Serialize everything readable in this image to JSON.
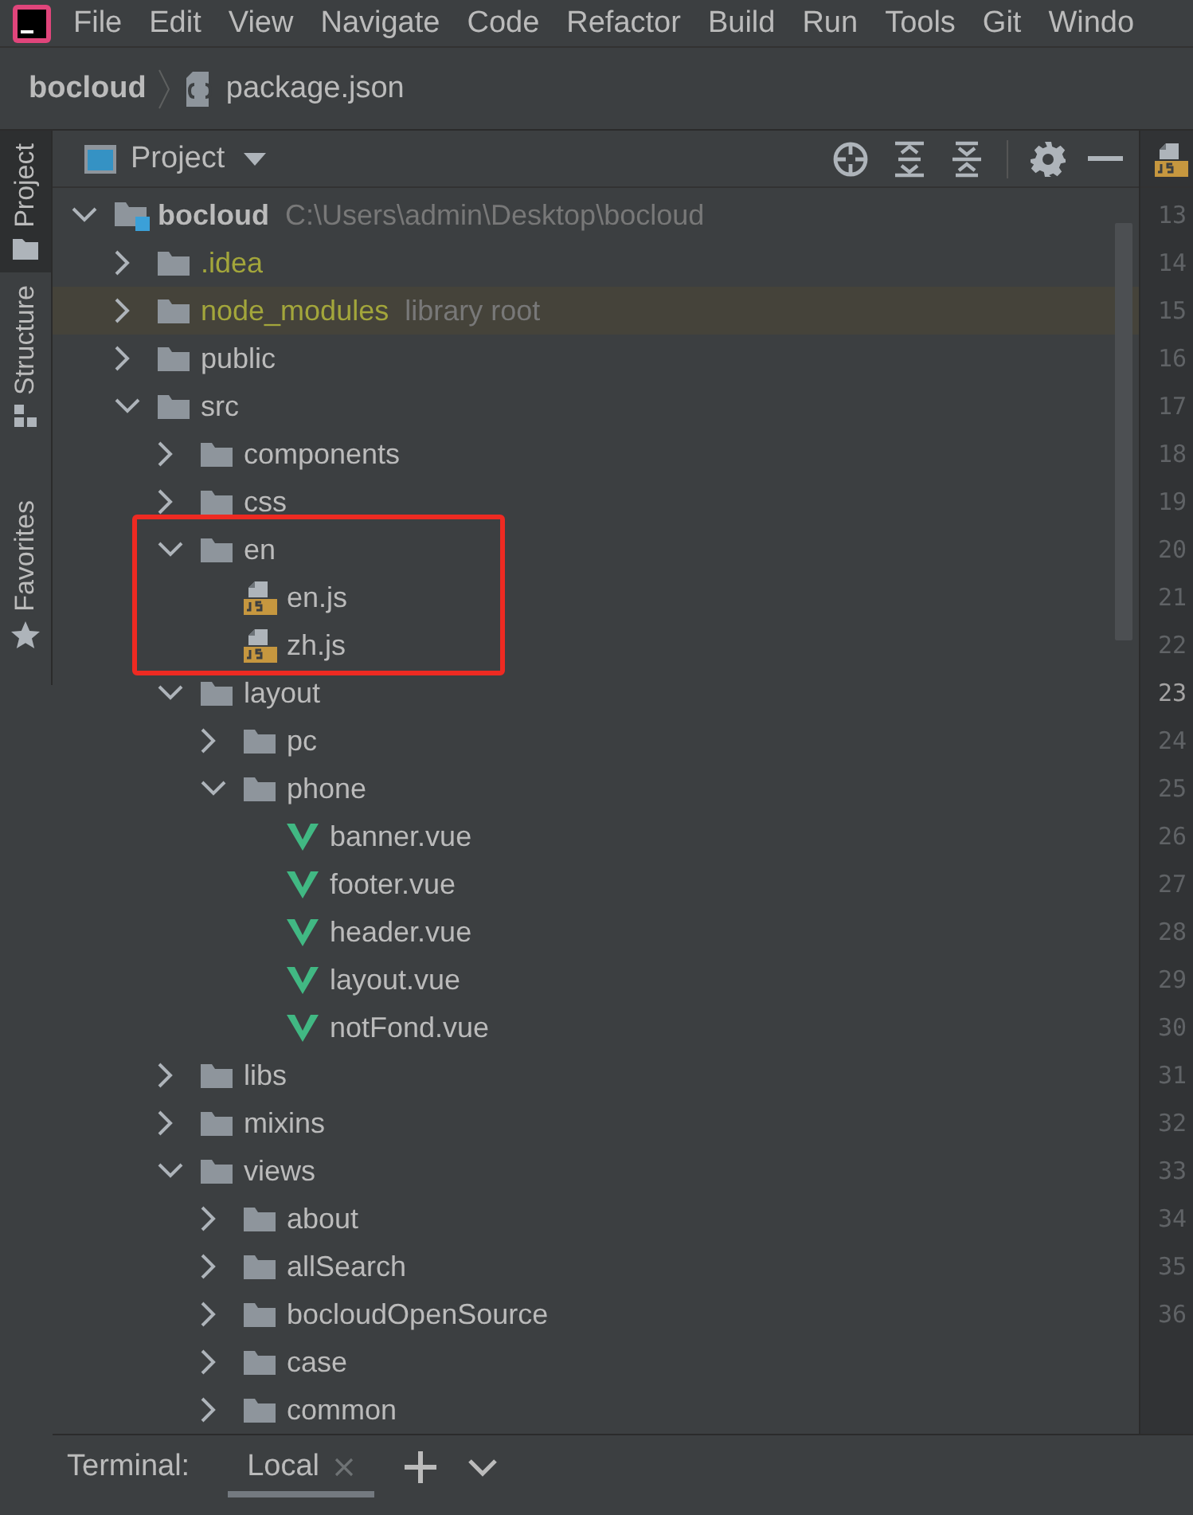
{
  "menu": [
    {
      "label": "File"
    },
    {
      "label": "Edit"
    },
    {
      "label": "View"
    },
    {
      "label": "Navigate"
    },
    {
      "label": "Code"
    },
    {
      "label": "Refactor"
    },
    {
      "label": "Build"
    },
    {
      "label": "Run"
    },
    {
      "label": "Tools"
    },
    {
      "label": "Git"
    },
    {
      "label": "Windo"
    }
  ],
  "breadcrumb": {
    "project": "bocloud",
    "file": "package.json"
  },
  "tool_strip": [
    {
      "label": "Project",
      "selected": true,
      "kind": "project"
    },
    {
      "label": "Structure",
      "selected": false,
      "kind": "structure"
    },
    {
      "label": "Favorites",
      "selected": false,
      "kind": "favorites"
    }
  ],
  "project_panel": {
    "title": "Project"
  },
  "tree": {
    "name": "bocloud",
    "kind": "module",
    "expanded": true,
    "path": "C:\\Users\\admin\\Desktop\\bocloud",
    "children": [
      {
        "name": ".idea",
        "kind": "folder",
        "expanded": false,
        "ignored": true
      },
      {
        "name": "node_modules",
        "kind": "folder",
        "expanded": false,
        "ignored": true,
        "library": true,
        "hint": "library root"
      },
      {
        "name": "public",
        "kind": "folder",
        "expanded": false
      },
      {
        "name": "src",
        "kind": "folder",
        "expanded": true,
        "children": [
          {
            "name": "components",
            "kind": "folder",
            "expanded": false
          },
          {
            "name": "css",
            "kind": "folder",
            "expanded": false
          },
          {
            "name": "en",
            "kind": "folder",
            "expanded": true,
            "highlighted": true,
            "children": [
              {
                "name": "en.js",
                "kind": "js"
              },
              {
                "name": "zh.js",
                "kind": "js"
              }
            ]
          },
          {
            "name": "layout",
            "kind": "folder",
            "expanded": true,
            "children": [
              {
                "name": "pc",
                "kind": "folder",
                "expanded": false
              },
              {
                "name": "phone",
                "kind": "folder",
                "expanded": true,
                "children": [
                  {
                    "name": "banner.vue",
                    "kind": "vue"
                  },
                  {
                    "name": "footer.vue",
                    "kind": "vue"
                  },
                  {
                    "name": "header.vue",
                    "kind": "vue"
                  },
                  {
                    "name": "layout.vue",
                    "kind": "vue"
                  },
                  {
                    "name": "notFond.vue",
                    "kind": "vue"
                  }
                ]
              }
            ]
          },
          {
            "name": "libs",
            "kind": "folder",
            "expanded": false
          },
          {
            "name": "mixins",
            "kind": "folder",
            "expanded": false
          },
          {
            "name": "views",
            "kind": "folder",
            "expanded": true,
            "children": [
              {
                "name": "about",
                "kind": "folder",
                "expanded": false
              },
              {
                "name": "allSearch",
                "kind": "folder",
                "expanded": false
              },
              {
                "name": "bocloudOpenSource",
                "kind": "folder",
                "expanded": false
              },
              {
                "name": "case",
                "kind": "folder",
                "expanded": false
              },
              {
                "name": "common",
                "kind": "folder",
                "expanded": false
              }
            ]
          }
        ]
      }
    ]
  },
  "gutter": [
    {
      "number": "13",
      "current": false
    },
    {
      "number": "14",
      "current": false
    },
    {
      "number": "15",
      "current": false
    },
    {
      "number": "16",
      "current": false
    },
    {
      "number": "17",
      "current": false
    },
    {
      "number": "18",
      "current": false
    },
    {
      "number": "19",
      "current": false
    },
    {
      "number": "20",
      "current": false
    },
    {
      "number": "21",
      "current": false
    },
    {
      "number": "22",
      "current": false
    },
    {
      "number": "23",
      "current": true
    },
    {
      "number": "24",
      "current": false
    },
    {
      "number": "25",
      "current": false
    },
    {
      "number": "26",
      "current": false
    },
    {
      "number": "27",
      "current": false
    },
    {
      "number": "28",
      "current": false
    },
    {
      "number": "29",
      "current": false
    },
    {
      "number": "30",
      "current": false
    },
    {
      "number": "31",
      "current": false
    },
    {
      "number": "32",
      "current": false
    },
    {
      "number": "33",
      "current": false
    },
    {
      "number": "34",
      "current": false
    },
    {
      "number": "35",
      "current": false
    },
    {
      "number": "36",
      "current": false
    }
  ],
  "terminal": {
    "label": "Terminal:",
    "tabs": [
      {
        "label": "Local",
        "selected": true
      }
    ]
  }
}
